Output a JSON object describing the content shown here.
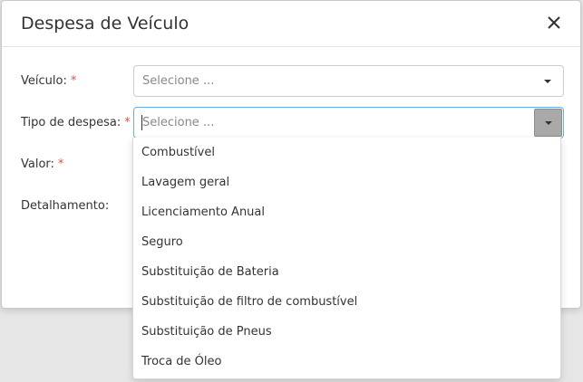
{
  "modal": {
    "title": "Despesa de Veículo"
  },
  "form": {
    "veiculo": {
      "label": "Veículo:",
      "required_mark": "*",
      "placeholder": "Selecione ..."
    },
    "tipo_despesa": {
      "label": "Tipo de despesa:",
      "required_mark": "*",
      "placeholder": "Selecione ..."
    },
    "valor": {
      "label": "Valor:",
      "required_mark": "*"
    },
    "detalhamento": {
      "label": "Detalhamento:"
    }
  },
  "dropdown": {
    "options": [
      "Combustível",
      "Lavagem geral",
      "Licenciamento Anual",
      "Seguro",
      "Substituição de Bateria",
      "Substituição de filtro de combustível",
      "Substituição de Pneus",
      "Troca de Óleo"
    ]
  },
  "colors": {
    "required": "#d9534f",
    "focus_border": "#66afe9"
  }
}
